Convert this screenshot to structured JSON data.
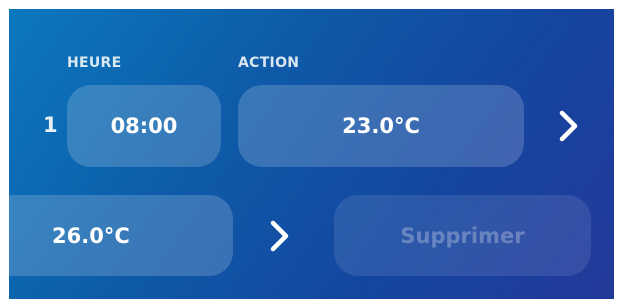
{
  "columns": {
    "time_label": "HEURE",
    "action_label": "ACTION"
  },
  "row1": {
    "index": "1",
    "time": "08:00",
    "action_value": "23.0°C"
  },
  "row2": {
    "value": "26.0°C",
    "delete_label": "Supprimer"
  },
  "icons": {
    "row1_next": "chevron-right-icon",
    "row2_next": "chevron-right-icon"
  },
  "colors": {
    "gradient_start": "#0b78bd",
    "gradient_end": "#23399a",
    "pill_fill": "rgba(255,255,255,0.18)",
    "text": "#ffffff"
  }
}
